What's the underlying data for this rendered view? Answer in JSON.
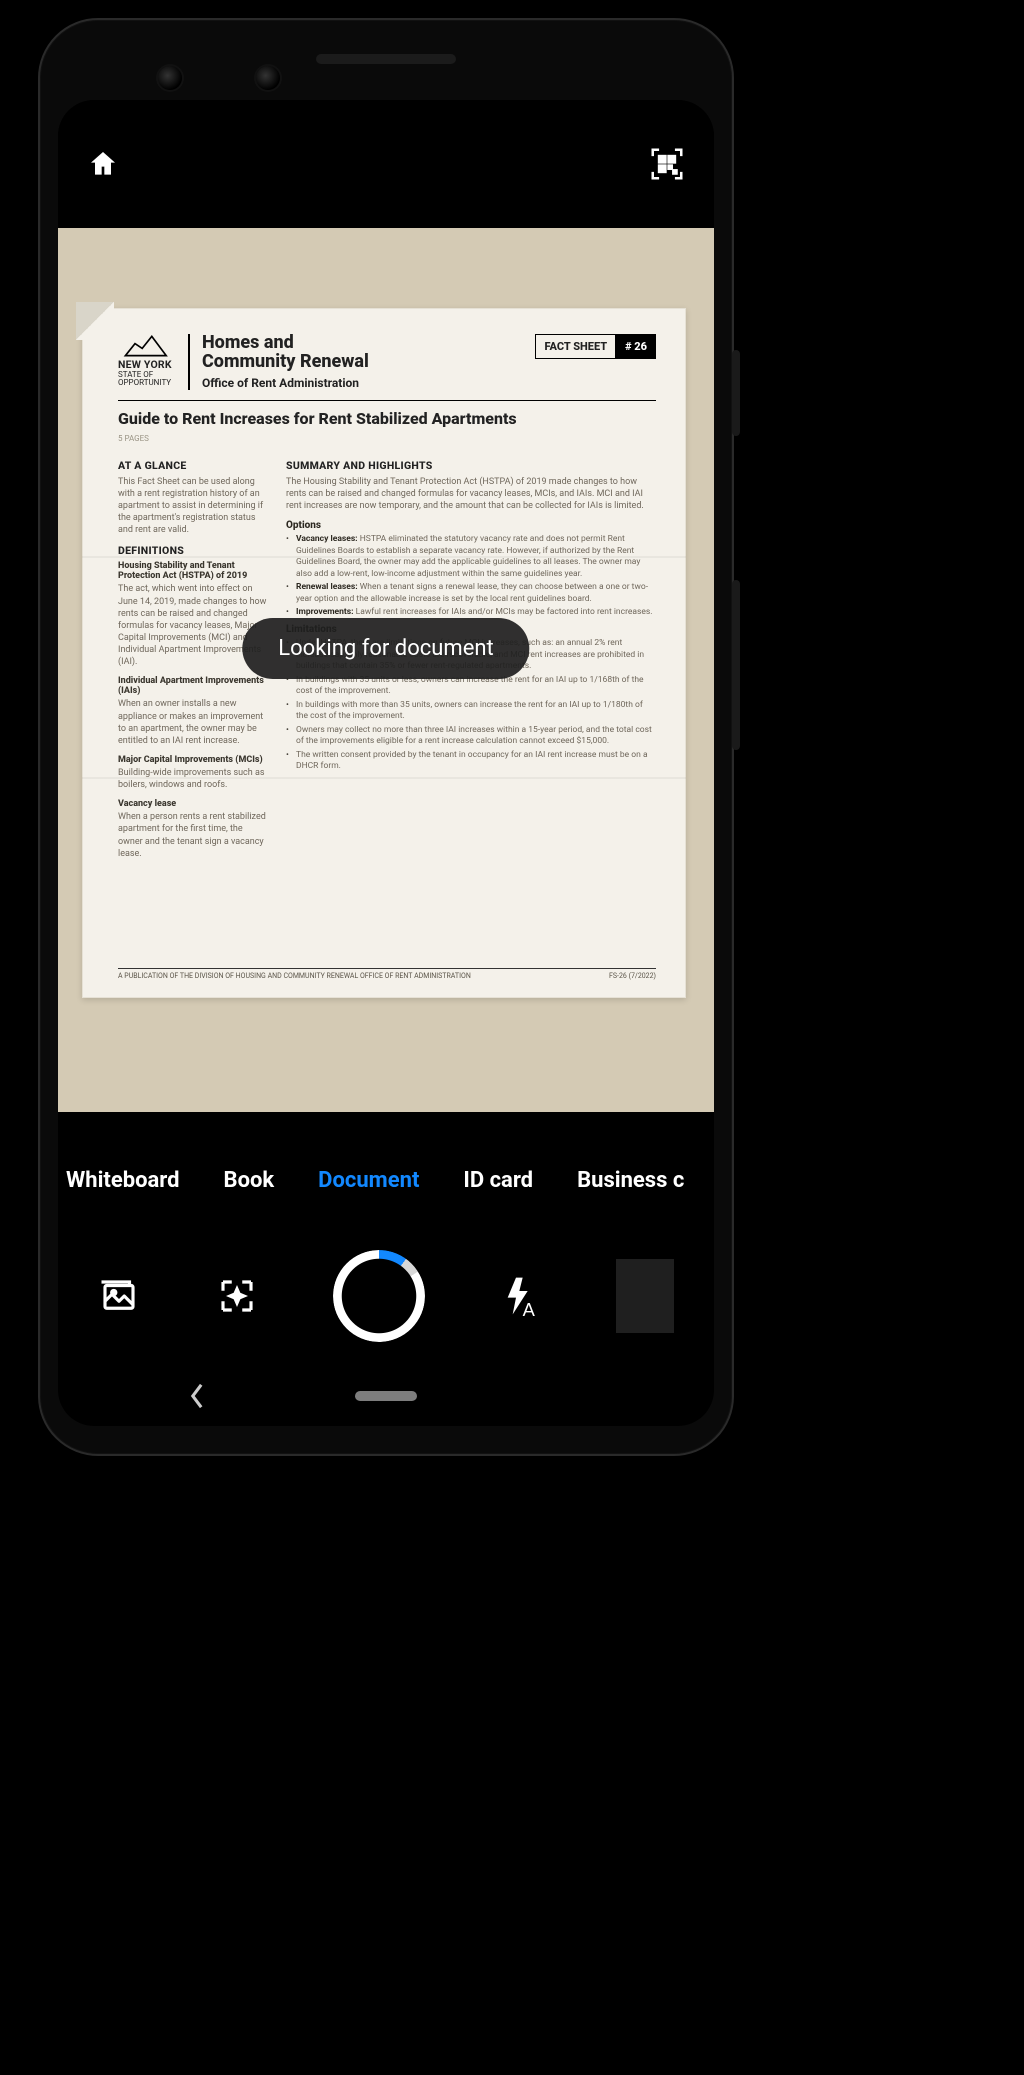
{
  "toast": {
    "text": "Looking for document"
  },
  "modes": {
    "items": [
      "Whiteboard",
      "Book",
      "Document",
      "ID card",
      "Business c"
    ],
    "active_index": 2
  },
  "icons": {
    "home": "home-icon",
    "qr": "qr-scan-icon",
    "gallery": "gallery-icon",
    "auto_enhance": "auto-enhance-icon",
    "flash_auto": "flash-auto-icon"
  },
  "viewfinder_document": {
    "agency_state": "NEW YORK",
    "agency_state_sub": "STATE OF\nOPPORTUNITY",
    "agency_line1": "Homes and",
    "agency_line2": "Community Renewal",
    "agency_office": "Office of Rent Administration",
    "badge_label": "FACT SHEET",
    "badge_num": "# 26",
    "title": "Guide to Rent Increases for Rent Stabilized Apartments",
    "pages": "5 PAGES",
    "left": {
      "glance_h": "AT A GLANCE",
      "glance_p": "This Fact Sheet can be used along with a rent registration history of an apartment to assist in determining if the apartment's registration status and rent are valid.",
      "def_h": "DEFINITIONS",
      "def1_h": "Housing Stability and Tenant Protection Act (HSTPA) of 2019",
      "def1_p": "The act, which went into effect on June 14, 2019, made changes to how rents can be raised and changed formulas for vacancy leases, Major Capital Improvements (MCI) and Individual Apartment Improvements (IAI).",
      "def2_h": "Individual Apartment Improvements (IAIs)",
      "def2_p": "When an owner installs a new appliance or makes an improvement to an apartment, the owner may be entitled to an IAI rent increase.",
      "def3_h": "Major Capital Improvements (MCIs)",
      "def3_p": "Building-wide improvements such as boilers, windows and roofs.",
      "def4_h": "Vacancy lease",
      "def4_p": "When a person rents a rent stabilized apartment for the first time, the owner and the tenant sign a vacancy lease."
    },
    "right": {
      "sum_h": "SUMMARY AND HIGHLIGHTS",
      "sum_p": "The Housing Stability and Tenant Protection Act (HSTPA) of 2019 made changes to how rents can be raised and changed formulas for vacancy leases, MCIs, and IAIs. MCI and IAI rent increases are now temporary, and the amount that can be collected for IAIs is limited.",
      "opt_h": "Options",
      "opt_b1": "Vacancy leases: HSTPA eliminated the statutory vacancy rate and does not permit Rent Guidelines Boards to establish a separate vacancy rate. However, if authorized by the Rent Guidelines Board, the owner may add the applicable guidelines to all leases. The owner may also add a low-rent, low-income adjustment within the same guidelines year.",
      "opt_b2": "Renewal leases: When a tenant signs a renewal lease, they can choose between a one or two-year option and the allowable increase is set by the local rent guidelines board.",
      "opt_b3": "Improvements: Lawful rent increases for IAIs and/or MCIs may be factored into rent increases.",
      "lim_h": "Limitations",
      "lim_b1": "Under HSTPA, there are limitations on future MCI increases, such as: an annual 2% rent increase cap, only reasonable costs are recoverable, and MCI rent increases are prohibited in buildings that contain 35% or fewer rent-regulated apartments.",
      "lim_b2": "In buildings with 35 units or less, owners can increase the rent for an IAI up to 1/168th of the cost of the improvement.",
      "lim_b3": "In buildings with more than 35 units, owners can increase the rent for an IAI up to 1/180th of the cost of the improvement.",
      "lim_b4": "Owners may collect no more than three IAI increases within a 15-year period, and the total cost of the improvements eligible for a rent increase calculation cannot exceed $15,000.",
      "lim_b5": "The written consent provided by the tenant in occupancy for an IAI rent increase must be on a DHCR form."
    },
    "pubfoot_l": "A PUBLICATION OF THE DIVISION OF HOUSING AND COMMUNITY RENEWAL OFFICE OF RENT ADMINISTRATION",
    "pubfoot_r": "FS-26 (7/2022)"
  }
}
